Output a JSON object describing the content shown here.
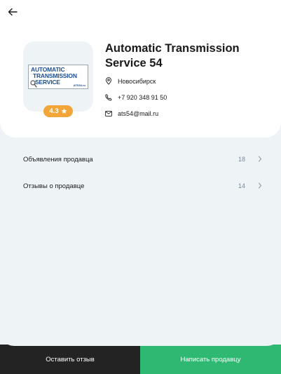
{
  "header": {
    "back_icon": "arrow-left-icon"
  },
  "seller": {
    "name": "Automatic Transmission Service 54",
    "logo": {
      "line1": "AUTOMATIC",
      "line2": "TRANSMISSION",
      "line3": "SERVICE",
      "site": "ATS54.ru",
      "colors": {
        "text": "#1d4f92",
        "border": "#9aa7b3"
      }
    },
    "rating": "4.3",
    "rating_icon": "star-icon",
    "city": "Новосибирск",
    "city_icon": "location-pin-icon",
    "phone": "+7 920 348 91 50",
    "phone_icon": "phone-icon",
    "email": "ats54@mail.ru",
    "email_icon": "mail-icon"
  },
  "menu": {
    "items": [
      {
        "label": "Объявления продавца",
        "count": "18",
        "icon": "chevron-right-icon"
      },
      {
        "label": "Отзывы о продавце",
        "count": "14",
        "icon": "chevron-right-icon"
      }
    ]
  },
  "actions": {
    "leave_review": "Оставить отзыв",
    "write_seller": "Написать продавцу"
  },
  "colors": {
    "rating_badge": "#f2a63a",
    "primary_button": "#2eb872",
    "dark_button": "#232323",
    "background": "#eef3f6"
  }
}
